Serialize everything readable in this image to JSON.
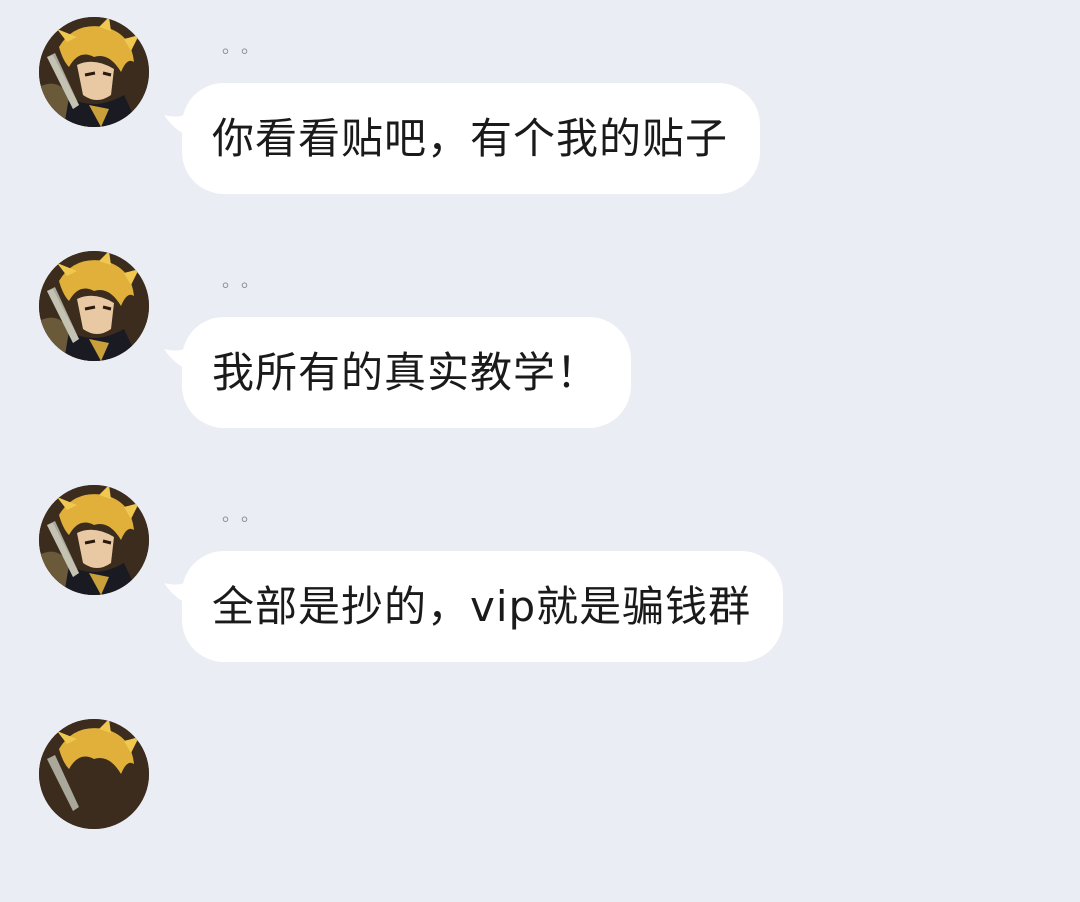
{
  "messages": [
    {
      "sender": "。。",
      "text": "你看看贴吧，有个我的贴子",
      "avatar_icon": "anime-character-avatar"
    },
    {
      "sender": "。。",
      "text": "我所有的真实教学！",
      "avatar_icon": "anime-character-avatar"
    },
    {
      "sender": "。。",
      "text": "全部是抄的，vip就是骗钱群",
      "avatar_icon": "anime-character-avatar"
    },
    {
      "sender": "",
      "text": "",
      "avatar_icon": "anime-character-avatar"
    }
  ],
  "colors": {
    "background": "#ebedf5",
    "bubble": "#ffffff",
    "text": "#1a1a1a",
    "sender": "#8a8f99"
  }
}
